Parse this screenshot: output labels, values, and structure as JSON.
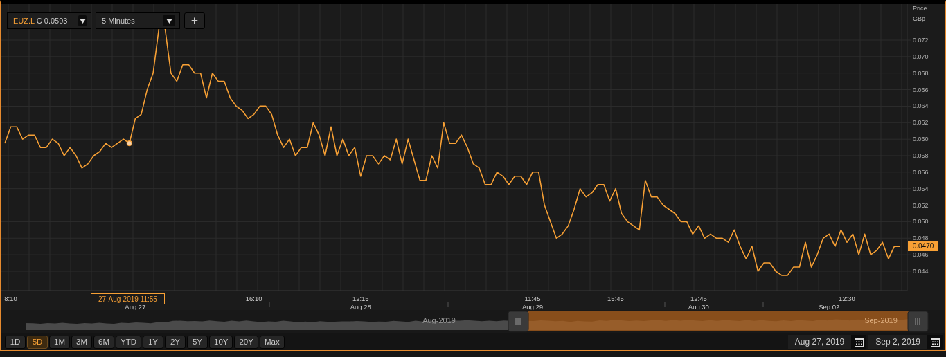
{
  "toolbar": {
    "symbol": "EUZ.L",
    "close_label": "C",
    "close_value": "0.0593",
    "interval": "5 Minutes",
    "add_button": "+"
  },
  "chart": {
    "price_label": "Price",
    "currency": "GBp",
    "last_price": "0.0470",
    "tooltip": "27-Aug-2019 11:55",
    "date_labels": [
      "Aug 27",
      "Aug 28",
      "Aug 29",
      "Aug 30",
      "Sep 02"
    ],
    "chart_data": {
      "type": "line",
      "grid": true,
      "ylim": [
        0.04165,
        0.07636
      ],
      "yticks": [
        {
          "value": 0.044,
          "label": "0.044"
        },
        {
          "value": 0.046,
          "label": "0.046"
        },
        {
          "value": 0.048,
          "label": "0.048"
        },
        {
          "value": 0.05,
          "label": "0.050"
        },
        {
          "value": 0.052,
          "label": "0.052"
        },
        {
          "value": 0.054,
          "label": "0.054"
        },
        {
          "value": 0.056,
          "label": "0.056"
        },
        {
          "value": 0.058,
          "label": "0.058"
        },
        {
          "value": 0.06,
          "label": "0.060"
        },
        {
          "value": 0.062,
          "label": "0.062"
        },
        {
          "value": 0.064,
          "label": "0.064"
        },
        {
          "value": 0.066,
          "label": "0.066"
        },
        {
          "value": 0.068,
          "label": "0.068"
        },
        {
          "value": 0.07,
          "label": "0.070"
        },
        {
          "value": 0.072,
          "label": "0.072"
        }
      ],
      "categories": [
        null,
        "8:10",
        null,
        null,
        null,
        null,
        null,
        null,
        null,
        null,
        null,
        null,
        null,
        null,
        null,
        null,
        null,
        null,
        null,
        null,
        null,
        null,
        null,
        null,
        null,
        null,
        null,
        null,
        null,
        null,
        null,
        null,
        null,
        null,
        null,
        null,
        null,
        null,
        null,
        null,
        null,
        null,
        "16:10",
        null,
        null,
        null,
        null,
        null,
        null,
        null,
        null,
        null,
        null,
        null,
        null,
        null,
        null,
        null,
        null,
        null,
        "12:15",
        null,
        null,
        null,
        null,
        null,
        null,
        null,
        null,
        null,
        null,
        null,
        null,
        null,
        null,
        null,
        null,
        null,
        null,
        null,
        null,
        null,
        null,
        null,
        null,
        null,
        null,
        null,
        null,
        "11:45",
        null,
        null,
        null,
        null,
        null,
        null,
        null,
        null,
        null,
        null,
        null,
        null,
        null,
        "15:45",
        null,
        null,
        null,
        null,
        null,
        null,
        null,
        null,
        null,
        null,
        null,
        null,
        null,
        "12:45",
        null,
        null,
        null,
        null,
        null,
        null,
        null,
        null,
        null,
        null,
        null,
        null,
        null,
        null,
        null,
        null,
        null,
        null,
        null,
        null,
        null,
        null,
        null,
        null,
        "12:30",
        null,
        null,
        null,
        null,
        null,
        null,
        null,
        null,
        null
      ],
      "series": [
        {
          "color": "#f7a035",
          "values": [
            0.0595,
            0.0615,
            0.0615,
            0.06,
            0.0605,
            0.0605,
            0.059,
            0.059,
            0.06,
            0.0595,
            0.058,
            0.059,
            0.058,
            0.0565,
            0.057,
            0.058,
            0.0585,
            0.0595,
            0.059,
            0.0595,
            0.06,
            0.0595,
            0.0625,
            0.063,
            0.066,
            0.068,
            0.0735,
            0.0735,
            0.068,
            0.067,
            0.069,
            0.069,
            0.068,
            0.068,
            0.065,
            0.068,
            0.067,
            0.067,
            0.065,
            0.064,
            0.0635,
            0.0625,
            0.063,
            0.064,
            0.064,
            0.063,
            0.0605,
            0.059,
            0.06,
            0.058,
            0.059,
            0.059,
            0.062,
            0.0605,
            0.058,
            0.0615,
            0.058,
            0.06,
            0.058,
            0.059,
            0.0555,
            0.058,
            0.058,
            0.057,
            0.058,
            0.0575,
            0.06,
            0.057,
            0.06,
            0.0575,
            0.055,
            0.055,
            0.058,
            0.0565,
            0.062,
            0.0595,
            0.0595,
            0.0605,
            0.059,
            0.057,
            0.0565,
            0.0545,
            0.0545,
            0.056,
            0.0555,
            0.0545,
            0.0555,
            0.0555,
            0.0545,
            0.056,
            0.056,
            0.052,
            0.05,
            0.048,
            0.0485,
            0.0495,
            0.0515,
            0.054,
            0.053,
            0.0535,
            0.0545,
            0.0545,
            0.0525,
            0.054,
            0.051,
            0.05,
            0.0495,
            0.049,
            0.055,
            0.053,
            0.053,
            0.052,
            0.0515,
            0.051,
            0.05,
            0.05,
            0.0485,
            0.0495,
            0.048,
            0.0485,
            0.048,
            0.048,
            0.0475,
            0.049,
            0.047,
            0.0455,
            0.047,
            0.044,
            0.045,
            0.045,
            0.044,
            0.0435,
            0.0435,
            0.0445,
            0.0445,
            0.0475,
            0.0445,
            0.046,
            0.048,
            0.0485,
            0.047,
            0.049,
            0.0475,
            0.0485,
            0.046,
            0.0485,
            0.046,
            0.0465,
            0.0475,
            0.0455,
            0.047,
            0.047
          ]
        }
      ]
    }
  },
  "navigator": {
    "labels": [
      "Aug-2019",
      "Sep-2019"
    ]
  },
  "ranges": [
    {
      "label": "1D",
      "selected": false
    },
    {
      "label": "5D",
      "selected": true
    },
    {
      "label": "1M",
      "selected": false
    },
    {
      "label": "3M",
      "selected": false
    },
    {
      "label": "6M",
      "selected": false
    },
    {
      "label": "YTD",
      "selected": false
    },
    {
      "label": "1Y",
      "selected": false
    },
    {
      "label": "2Y",
      "selected": false
    },
    {
      "label": "5Y",
      "selected": false
    },
    {
      "label": "10Y",
      "selected": false
    },
    {
      "label": "20Y",
      "selected": false
    },
    {
      "label": "Max",
      "selected": false
    }
  ],
  "date_range": {
    "from": "Aug 27, 2019",
    "to": "Sep 2, 2019"
  }
}
